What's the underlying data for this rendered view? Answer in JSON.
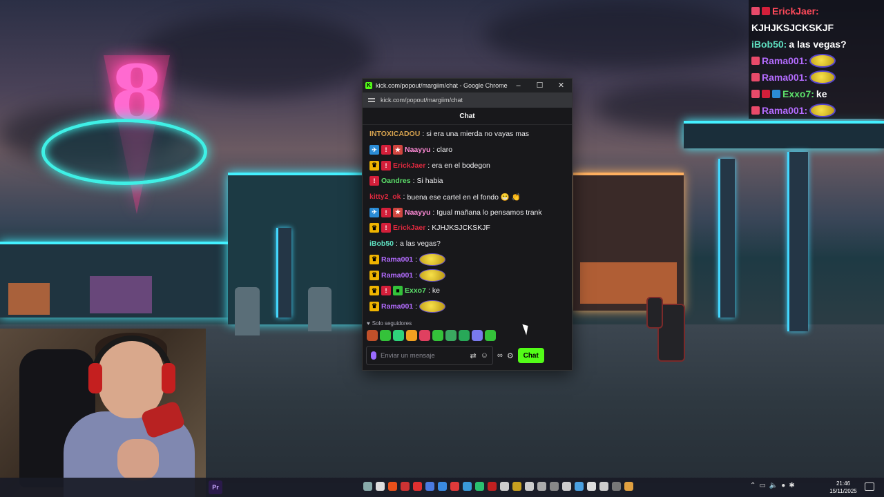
{
  "window": {
    "title": "kick.com/popout/margiim/chat - Google Chrome",
    "url": "kick.com/popout/margiim/chat",
    "minimize_glyph": "–",
    "maximize_glyph": "☐",
    "close_glyph": "✕"
  },
  "chat": {
    "header": "Chat",
    "messages": [
      {
        "user": "INTOXICADOU",
        "color": "#d6a24e",
        "badges": [],
        "text": "si era una mierda no vayas mas"
      },
      {
        "user": "Naayyu",
        "color": "#ff8ad6",
        "badges": [
          "vip",
          "og",
          "sub"
        ],
        "text": "claro"
      },
      {
        "user": "ErickJaer",
        "color": "#e0293f",
        "badges": [
          "crown",
          "og"
        ],
        "text": "era en el bodegon"
      },
      {
        "user": "Oandres",
        "color": "#5ce06a",
        "badges": [
          "og"
        ],
        "text": "Si habia"
      },
      {
        "user": "kitty2_ok",
        "color": "#e0293f",
        "badges": [],
        "text": "buena ese cartel en el fondo 😁 👏"
      },
      {
        "user": "Naayyu",
        "color": "#ff8ad6",
        "badges": [
          "vip",
          "og",
          "sub"
        ],
        "text": "Igual mañana lo pensamos trank"
      },
      {
        "user": "ErickJaer",
        "color": "#e0293f",
        "badges": [
          "crown",
          "og"
        ],
        "text": "KJHJKSJCKSKJF"
      },
      {
        "user": "iBob50",
        "color": "#5ee0c0",
        "badges": [],
        "text": "a las vegas?"
      },
      {
        "user": "Rama001",
        "color": "#b46cff",
        "badges": [
          "crown"
        ],
        "text": "",
        "emote": true
      },
      {
        "user": "Rama001",
        "color": "#b46cff",
        "badges": [
          "crown"
        ],
        "text": "",
        "emote": true
      },
      {
        "user": "Exxo7",
        "color": "#5ce06a",
        "badges": [
          "crown",
          "og",
          "green"
        ],
        "text": "ke"
      },
      {
        "user": "Rama001",
        "color": "#b46cff",
        "badges": [
          "crown"
        ],
        "text": "",
        "emote": true
      }
    ],
    "followers_only": "Solo seguidores",
    "input_placeholder": "Enviar un mensaje",
    "send_label": "Chat",
    "emote_colors": [
      "#c0502a",
      "#34c23a",
      "#2fd27a",
      "#f0a020",
      "#e04060",
      "#34c23a",
      "#3aa860",
      "#28a858",
      "#7a7aee",
      "#34c23a"
    ]
  },
  "overlay": {
    "lines": [
      {
        "user": "ErickJaer:",
        "color": "#ff4a5a",
        "badges": [
          "#e84a6a",
          "#d41f3a"
        ],
        "text": ""
      },
      {
        "user": "",
        "color": "#ffffff",
        "badges": [],
        "text": "KJHJKSJCKSKJF"
      },
      {
        "user": "iBob50:",
        "color": "#5ee0c0",
        "badges": [],
        "text": "a las vegas?"
      },
      {
        "user": "Rama001:",
        "color": "#b46cff",
        "badges": [
          "#e84a6a"
        ],
        "text": "",
        "emote": true
      },
      {
        "user": "Rama001:",
        "color": "#b46cff",
        "badges": [
          "#e84a6a"
        ],
        "text": "",
        "emote": true
      },
      {
        "user": "Exxo7:",
        "color": "#5ce06a",
        "badges": [
          "#e84a6a",
          "#d41f3a",
          "#2b8cd6"
        ],
        "text": "ke"
      },
      {
        "user": "Rama001:",
        "color": "#b46cff",
        "badges": [
          "#e84a6a"
        ],
        "text": "",
        "emote": true
      }
    ]
  },
  "taskbar": {
    "pinned_label": "Pr",
    "time": "21:46",
    "date": "15/11/2025",
    "app_colors": [
      "#8aa",
      "#ddd",
      "#e8501a",
      "#c33",
      "#e03030",
      "#4a7ae0",
      "#3a8ae0",
      "#e03a3a",
      "#3a9ad8",
      "#2ac070",
      "#c02020",
      "#ccc",
      "#c8a020",
      "#ccc",
      "#aaa",
      "#888",
      "#ccc",
      "#4aa0e0",
      "#ddd",
      "#ccc",
      "#777",
      "#e0a040"
    ]
  }
}
